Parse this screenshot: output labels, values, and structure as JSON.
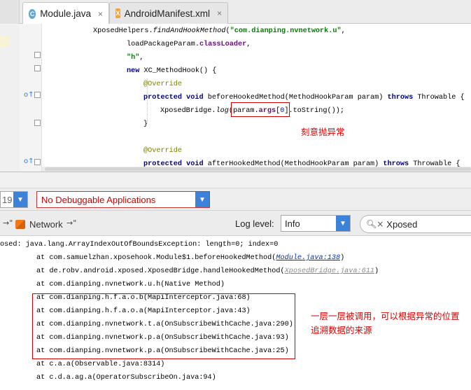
{
  "tabs": [
    {
      "label": "Module.java",
      "icon": "java-class-icon",
      "close": "×",
      "active": true
    },
    {
      "label": "AndroidManifest.xml",
      "icon": "xml-file-icon",
      "close": "×",
      "active": false
    }
  ],
  "editor": {
    "lines": [
      {
        "indent": "XposedHelpers.",
        "method": "findAndHookMethod",
        "open": "(",
        "str": "\"com.dianping.nvnetwork.u\"",
        "close": ","
      },
      {
        "text": "loadPackageParam.",
        "field": "classLoader",
        "tail": ","
      },
      {
        "str": "\"h\"",
        "tail": ","
      },
      {
        "kw": "new",
        "text": " XC_MethodHook() {"
      },
      {
        "ann": "@Override"
      },
      {
        "kw1": "protected",
        "kw2": "void",
        "text": " beforeHookedMethod(MethodHookParam param) ",
        "kw3": "throws",
        "tail": " Throwable {"
      },
      {
        "text": "XposedBridge.",
        "method": "log",
        "open": "(param.",
        "field": "args",
        "idx": "0",
        "tail": "].toString());"
      },
      {
        "text": "}"
      },
      {
        "ann": "@Override"
      },
      {
        "kw1": "protected",
        "kw2": "void",
        "text": " afterHookedMethod(MethodHookParam param) ",
        "kw3": "throws",
        "tail": " Throwable {"
      }
    ],
    "annotation": "刻意抛异常"
  },
  "logcat": {
    "device_value": "19",
    "app_value": "No Debuggable Applications",
    "left_chevron": "→\"",
    "monitors_label": "Network",
    "right_chevron": "→\"",
    "log_level_label": "Log level:",
    "log_level_value": "Info",
    "search_value": "Xposed",
    "lines": [
      {
        "text": "osed: java.lang.ArrayIndexOutOfBoundsException: length=0; index=0"
      },
      {
        "text": "at com.samuelzhan.xposehook.Module$1.beforeHookedMethod(",
        "link": "Module.java:138",
        "tail": ")"
      },
      {
        "text": "at de.robv.android.xposed.XposedBridge.handleHookedMethod(",
        "link_grey": "XposedBridge.java:611",
        "tail": ")"
      },
      {
        "text": "at com.dianping.nvnetwork.u.h(Native Method)"
      },
      {
        "text": "at com.dianping.h.f.a.o.b(MapiInterceptor.java:68)"
      },
      {
        "text": "at com.dianping.h.f.a.o.a(MapiInterceptor.java:43)"
      },
      {
        "text": "at com.dianping.nvnetwork.t.a(OnSubscribeWithCache.java:290)"
      },
      {
        "text": "at com.dianping.nvnetwork.p.a(OnSubscribeWithCache.java:93)"
      },
      {
        "text": "at com.dianping.nvnetwork.p.a(OnSubscribeWithCache.java:25)"
      },
      {
        "text": "at c.a.a(Observable.java:8314)"
      },
      {
        "text": "at c.d.a.ag.a(OperatorSubscribeOn.java:94)"
      }
    ],
    "annotation": "一层一层被调用，可以根据异常的位置追溯数据的来源"
  },
  "colors": {
    "annotation_red": "#e00000",
    "combo_blue": "#3c82d8",
    "keyword_navy": "#000080",
    "string_green": "#008000"
  }
}
